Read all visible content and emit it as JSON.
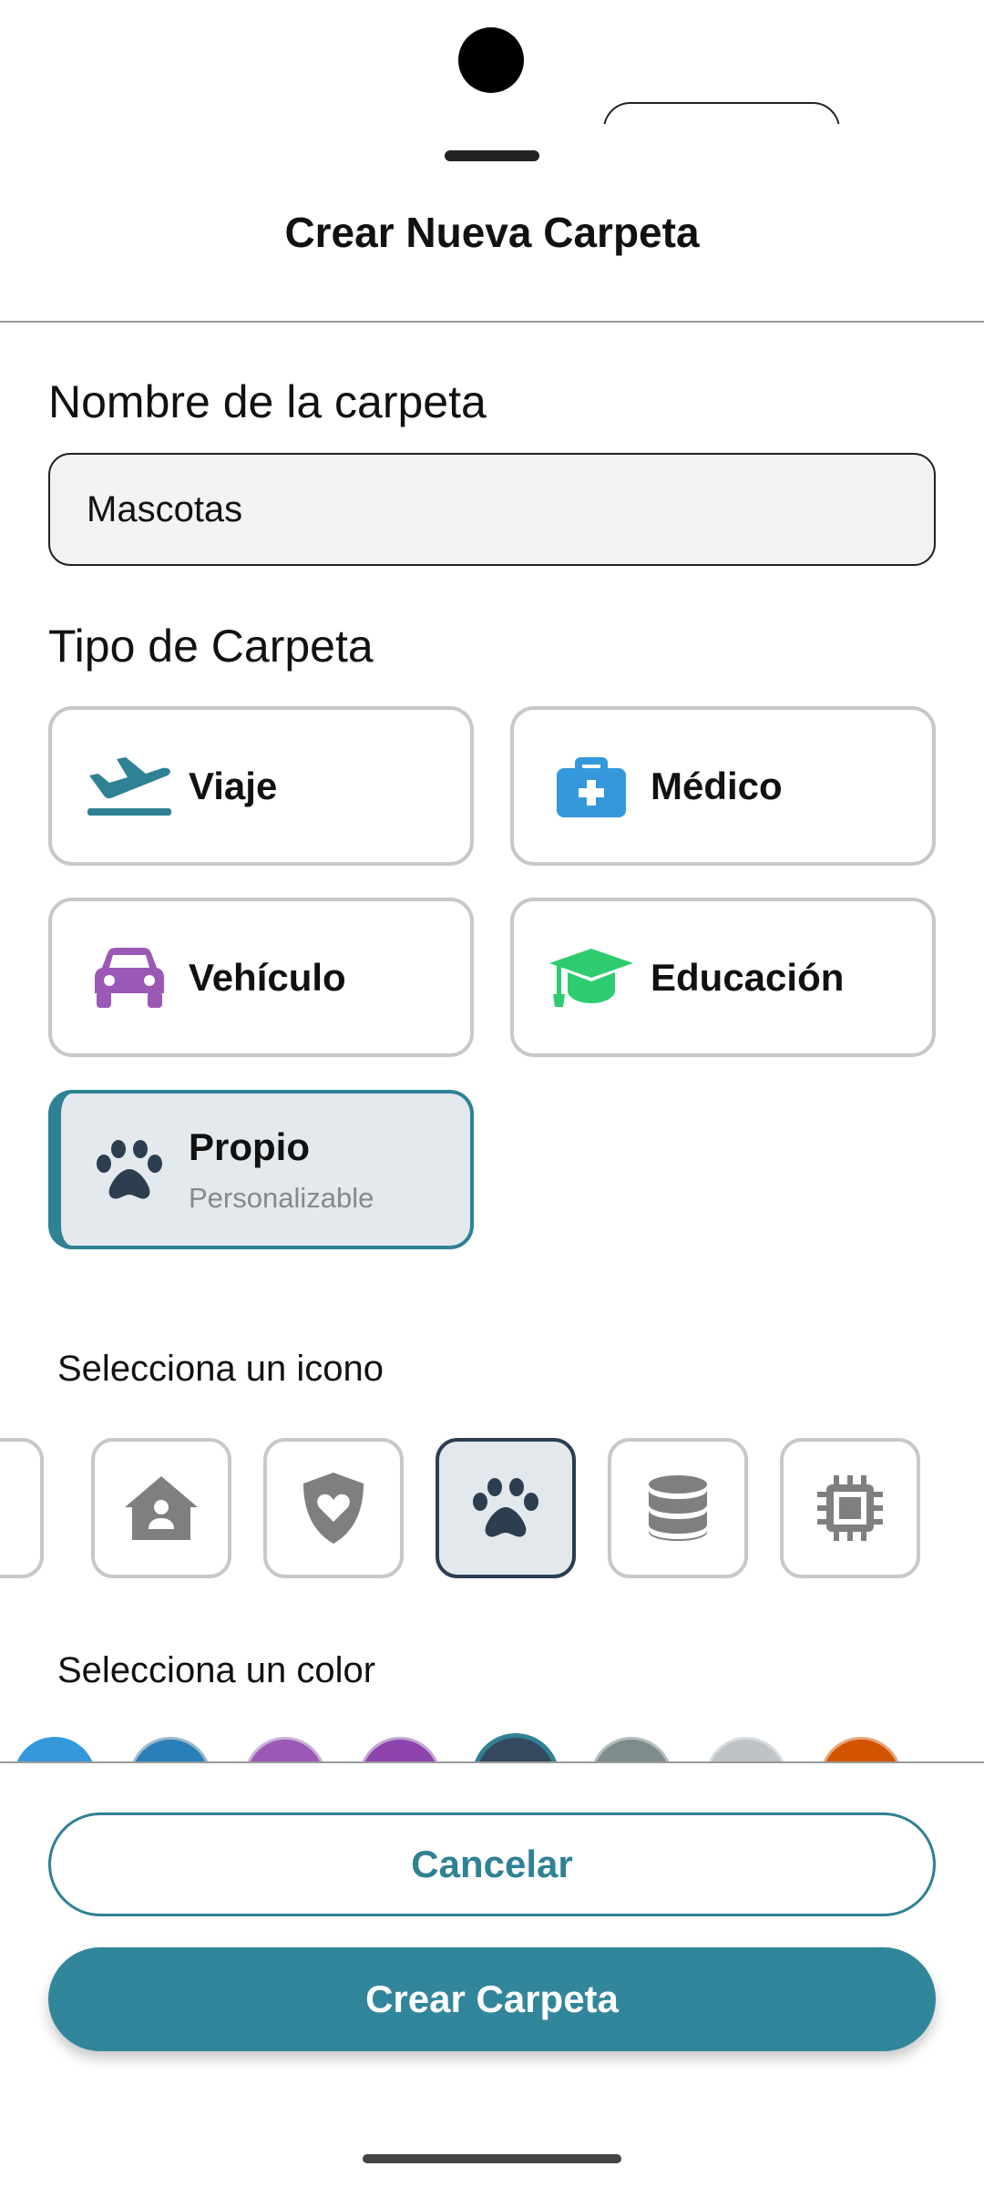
{
  "sheet": {
    "title": "Crear Nueva Carpeta"
  },
  "name_field": {
    "label": "Nombre de la carpeta",
    "value": "Mascotas"
  },
  "type_section": {
    "label": "Tipo de Carpeta",
    "options": [
      {
        "label": "Viaje",
        "icon": "plane-icon",
        "color": "#2f8194"
      },
      {
        "label": "Médico",
        "icon": "medkit-icon",
        "color": "#3498db"
      },
      {
        "label": "Vehículo",
        "icon": "car-icon",
        "color": "#9b59b6"
      },
      {
        "label": "Educación",
        "icon": "graduation-cap-icon",
        "color": "#2ecc71"
      },
      {
        "label": "Propio",
        "sublabel": "Personalizable",
        "icon": "paw-icon",
        "color": "#2c3e50",
        "selected": true
      }
    ]
  },
  "icon_section": {
    "label": "Selecciona un icono",
    "icons": [
      "home-user-icon",
      "shield-heart-icon",
      "paw-icon",
      "database-icon",
      "chip-icon"
    ],
    "selected": "paw-icon"
  },
  "color_section": {
    "label": "Selecciona un color",
    "colors": [
      "#3498db",
      "#2980b9",
      "#9b59b6",
      "#8e44ad",
      "#34495e",
      "#7f8c8d",
      "#bdc3c7",
      "#d35400"
    ],
    "selected": "#34495e"
  },
  "actions": {
    "cancel": "Cancelar",
    "create": "Crear Carpeta"
  }
}
